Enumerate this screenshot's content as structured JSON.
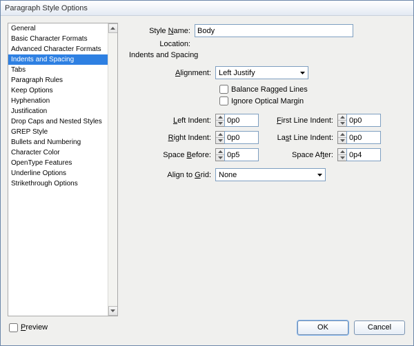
{
  "window": {
    "title": "Paragraph Style Options"
  },
  "sidebar": {
    "items": [
      {
        "label": "General"
      },
      {
        "label": "Basic Character Formats"
      },
      {
        "label": "Advanced Character Formats"
      },
      {
        "label": "Indents and Spacing",
        "selected": true
      },
      {
        "label": "Tabs"
      },
      {
        "label": "Paragraph Rules"
      },
      {
        "label": "Keep Options"
      },
      {
        "label": "Hyphenation"
      },
      {
        "label": "Justification"
      },
      {
        "label": "Drop Caps and Nested Styles"
      },
      {
        "label": "GREP Style"
      },
      {
        "label": "Bullets and Numbering"
      },
      {
        "label": "Character Color"
      },
      {
        "label": "OpenType Features"
      },
      {
        "label": "Underline Options"
      },
      {
        "label": "Strikethrough Options"
      }
    ]
  },
  "header": {
    "style_name_label": "Style Name:",
    "style_name_value": "Body",
    "location_label": "Location:",
    "section_title": "Indents and Spacing"
  },
  "fields": {
    "alignment_label": "Alignment:",
    "alignment_value": "Left Justify",
    "balance_ragged_label": "Balance Ragged Lines",
    "balance_ragged_checked": false,
    "ignore_optical_label": "Ignore Optical Margin",
    "ignore_optical_checked": false,
    "left_indent_label": "Left Indent:",
    "left_indent_value": "0p0",
    "first_line_indent_label": "First Line Indent:",
    "first_line_indent_value": "0p0",
    "right_indent_label": "Right Indent:",
    "right_indent_value": "0p0",
    "last_line_indent_label": "Last Line Indent:",
    "last_line_indent_value": "0p0",
    "space_before_label": "Space Before:",
    "space_before_value": "0p5",
    "space_after_label": "Space After:",
    "space_after_value": "0p4",
    "align_to_grid_label": "Align to Grid:",
    "align_to_grid_value": "None"
  },
  "footer": {
    "preview_label": "Preview",
    "preview_checked": false,
    "ok_label": "OK",
    "cancel_label": "Cancel"
  }
}
